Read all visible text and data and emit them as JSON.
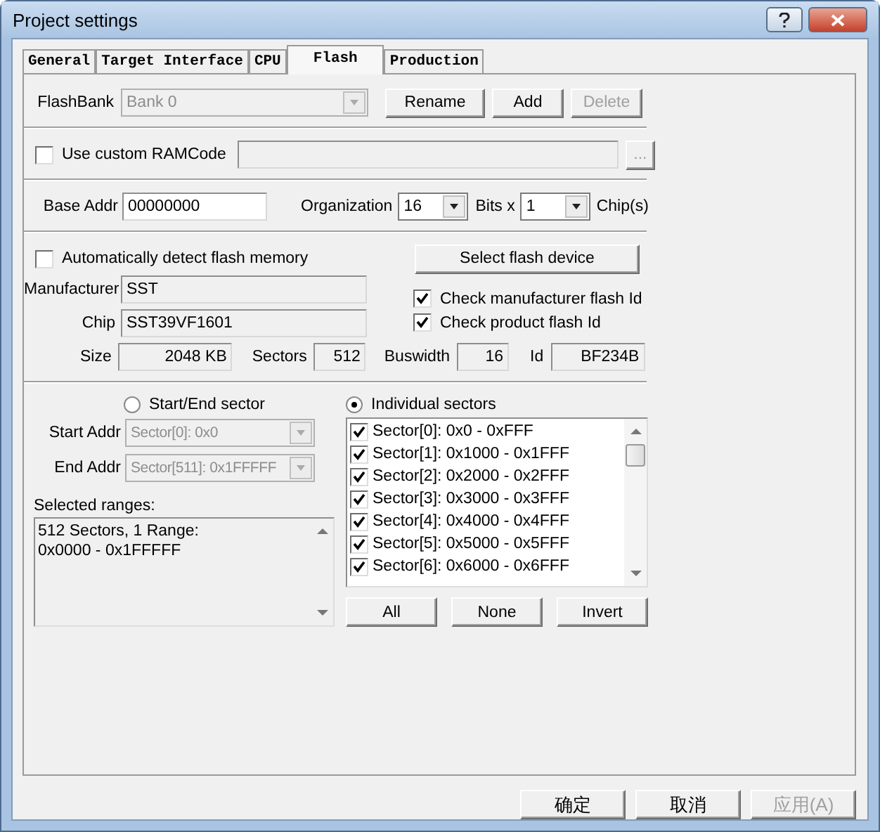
{
  "window": {
    "title": "Project settings"
  },
  "tabs": [
    {
      "label": "General",
      "selected": false
    },
    {
      "label": "Target Interface",
      "selected": false
    },
    {
      "label": "CPU",
      "selected": false
    },
    {
      "label": "Flash",
      "selected": true
    },
    {
      "label": "Production",
      "selected": false
    }
  ],
  "flash_bank": {
    "label": "FlashBank",
    "value": "Bank 0",
    "disabled": true
  },
  "bank_buttons": [
    {
      "label": "Rename",
      "disabled": false
    },
    {
      "label": "Add",
      "disabled": false
    },
    {
      "label": "Delete",
      "disabled": true
    }
  ],
  "ramcode": {
    "label": "Use custom RAMCode",
    "checked": false,
    "browse": "..."
  },
  "base_addr": {
    "label": "Base Addr",
    "value": "00000000"
  },
  "organization": {
    "label": "Organization",
    "bits_value": "16",
    "bits_label": "Bits x",
    "chips_value": "1",
    "chips_label": "Chip(s)"
  },
  "auto_detect": {
    "label": "Automatically detect flash memory",
    "checked": false
  },
  "select_button": "Select flash device",
  "device_fields": [
    {
      "label": "Manufacturer",
      "value": "SST"
    },
    {
      "label": "Chip",
      "value": "SST39VF1601"
    }
  ],
  "id_checks": [
    {
      "label": "Check manufacturer flash Id",
      "checked": true
    },
    {
      "label": "Check product flash Id",
      "checked": true
    }
  ],
  "stats": [
    {
      "label": "Size",
      "value": "2048 KB"
    },
    {
      "label": "Sectors",
      "value": "512"
    },
    {
      "label": "Buswidth",
      "value": "16"
    },
    {
      "label": "Id",
      "value": "BF234B"
    }
  ],
  "range_modes": [
    {
      "label": "Start/End sector",
      "selected": false
    },
    {
      "label": "Individual sectors",
      "selected": true
    }
  ],
  "addr_fields": [
    {
      "label": "Start Addr",
      "value": "Sector[0]: 0x0",
      "disabled": true
    },
    {
      "label": "End Addr",
      "value": "Sector[511]: 0x1FFFFF",
      "disabled": true
    }
  ],
  "selected_ranges": {
    "label": "Selected ranges:",
    "lines": [
      "512 Sectors, 1 Range:",
      "0x0000 - 0x1FFFFF"
    ]
  },
  "sectors": [
    {
      "label": "Sector[0]: 0x0 - 0xFFF",
      "checked": true
    },
    {
      "label": "Sector[1]: 0x1000 - 0x1FFF",
      "checked": true
    },
    {
      "label": "Sector[2]: 0x2000 - 0x2FFF",
      "checked": true
    },
    {
      "label": "Sector[3]: 0x3000 - 0x3FFF",
      "checked": true
    },
    {
      "label": "Sector[4]: 0x4000 - 0x4FFF",
      "checked": true
    },
    {
      "label": "Sector[5]: 0x5000 - 0x5FFF",
      "checked": true
    },
    {
      "label": "Sector[6]: 0x6000 - 0x6FFF",
      "checked": true
    }
  ],
  "sector_buttons": [
    "All",
    "None",
    "Invert"
  ],
  "dialog_buttons": [
    {
      "label": "确定",
      "disabled": false
    },
    {
      "label": "取消",
      "disabled": false
    },
    {
      "label": "应用(A)",
      "disabled": true
    }
  ]
}
